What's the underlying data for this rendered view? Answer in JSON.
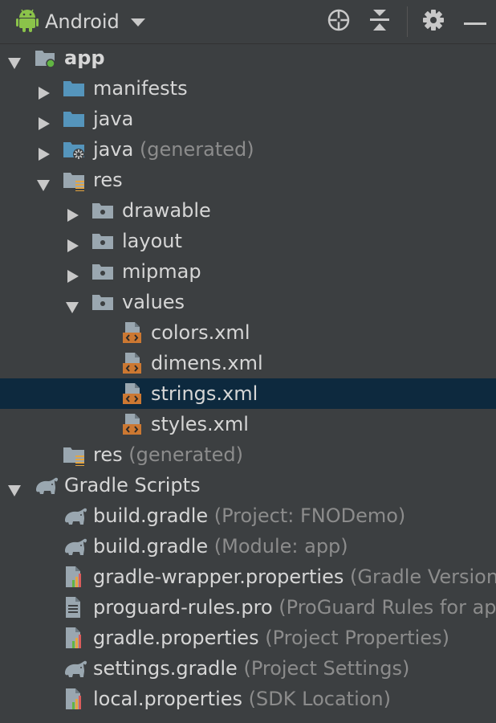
{
  "toolbar": {
    "title": "Android",
    "icons": [
      "android-icon",
      "chevron-down-icon",
      "locate-icon",
      "collapse-all-icon",
      "gear-icon",
      "hide-icon"
    ]
  },
  "tree": [
    {
      "label": "app",
      "sub": "",
      "level": 0,
      "arrow": "down",
      "icon": "module",
      "bold": true
    },
    {
      "label": "manifests",
      "sub": "",
      "level": 1,
      "arrow": "right",
      "icon": "folder-blue"
    },
    {
      "label": "java",
      "sub": "",
      "level": 1,
      "arrow": "right",
      "icon": "folder-blue"
    },
    {
      "label": "java",
      "sub": "(generated)",
      "level": 1,
      "arrow": "right",
      "icon": "folder-gen"
    },
    {
      "label": "res",
      "sub": "",
      "level": 1,
      "arrow": "down",
      "icon": "folder-res"
    },
    {
      "label": "drawable",
      "sub": "",
      "level": 2,
      "arrow": "right",
      "icon": "folder-pkg"
    },
    {
      "label": "layout",
      "sub": "",
      "level": 2,
      "arrow": "right",
      "icon": "folder-pkg"
    },
    {
      "label": "mipmap",
      "sub": "",
      "level": 2,
      "arrow": "right",
      "icon": "folder-pkg"
    },
    {
      "label": "values",
      "sub": "",
      "level": 2,
      "arrow": "down",
      "icon": "folder-pkg"
    },
    {
      "label": "colors.xml",
      "sub": "",
      "level": 3,
      "arrow": "",
      "icon": "xml"
    },
    {
      "label": "dimens.xml",
      "sub": "",
      "level": 3,
      "arrow": "",
      "icon": "xml"
    },
    {
      "label": "strings.xml",
      "sub": "",
      "level": 3,
      "arrow": "",
      "icon": "xml",
      "selected": true
    },
    {
      "label": "styles.xml",
      "sub": "",
      "level": 3,
      "arrow": "",
      "icon": "xml"
    },
    {
      "label": "res",
      "sub": "(generated)",
      "level": 1,
      "arrow": "",
      "icon": "folder-res"
    },
    {
      "label": "Gradle Scripts",
      "sub": "",
      "level": 0,
      "arrow": "down",
      "icon": "gradle"
    },
    {
      "label": "build.gradle",
      "sub": "(Project: FNODemo)",
      "level": 1,
      "arrow": "",
      "icon": "gradle"
    },
    {
      "label": "build.gradle",
      "sub": "(Module: app)",
      "level": 1,
      "arrow": "",
      "icon": "gradle"
    },
    {
      "label": "gradle-wrapper.properties",
      "sub": "(Gradle Version)",
      "level": 1,
      "arrow": "",
      "icon": "props"
    },
    {
      "label": "proguard-rules.pro",
      "sub": "(ProGuard Rules for app)",
      "level": 1,
      "arrow": "",
      "icon": "text"
    },
    {
      "label": "gradle.properties",
      "sub": "(Project Properties)",
      "level": 1,
      "arrow": "",
      "icon": "props"
    },
    {
      "label": "settings.gradle",
      "sub": "(Project Settings)",
      "level": 1,
      "arrow": "",
      "icon": "gradle"
    },
    {
      "label": "local.properties",
      "sub": "(SDK Location)",
      "level": 1,
      "arrow": "",
      "icon": "props"
    }
  ]
}
